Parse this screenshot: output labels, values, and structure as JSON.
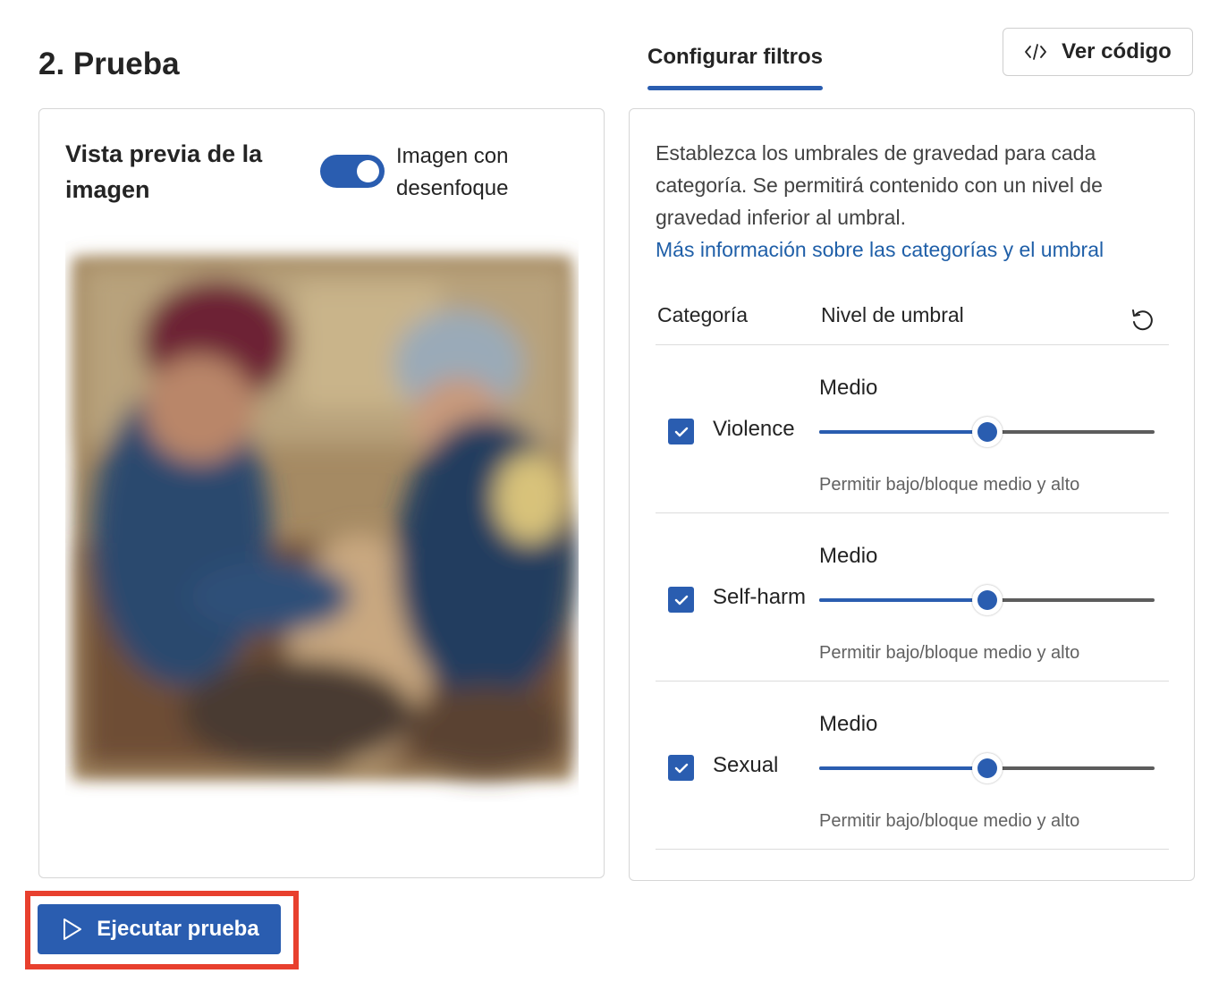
{
  "section": {
    "title": "2. Prueba"
  },
  "tabs": [
    {
      "label": "Configurar filtros",
      "active": true
    }
  ],
  "code_button": {
    "label": "Ver código",
    "icon": "code-icon"
  },
  "preview": {
    "title": "Vista previa de la imagen",
    "blur_toggle": {
      "label": "Imagen con desenfoque",
      "on": true
    }
  },
  "filters": {
    "description": "Establezca los umbrales de gravedad para cada categoría. Se permitirá contenido con un nivel de gravedad inferior al umbral.",
    "link": "Más información sobre las categorías y el umbral",
    "columns": {
      "category": "Categoría",
      "level": "Nivel de umbral"
    },
    "reset_icon": "reset-icon",
    "categories": [
      {
        "name": "Violence",
        "checked": true,
        "level": "Medio",
        "level_fraction": 0.5,
        "hint": "Permitir bajo/bloque medio y alto"
      },
      {
        "name": "Self-harm",
        "checked": true,
        "level": "Medio",
        "level_fraction": 0.5,
        "hint": "Permitir bajo/bloque medio y alto"
      },
      {
        "name": "Sexual",
        "checked": true,
        "level": "Medio",
        "level_fraction": 0.5,
        "hint": "Permitir bajo/bloque medio y alto"
      }
    ]
  },
  "run_button": {
    "label": "Ejecutar prueba",
    "icon": "play-icon"
  },
  "colors": {
    "accent": "#2a5db0",
    "highlight": "#e8402e",
    "link": "#1f5fa8"
  }
}
